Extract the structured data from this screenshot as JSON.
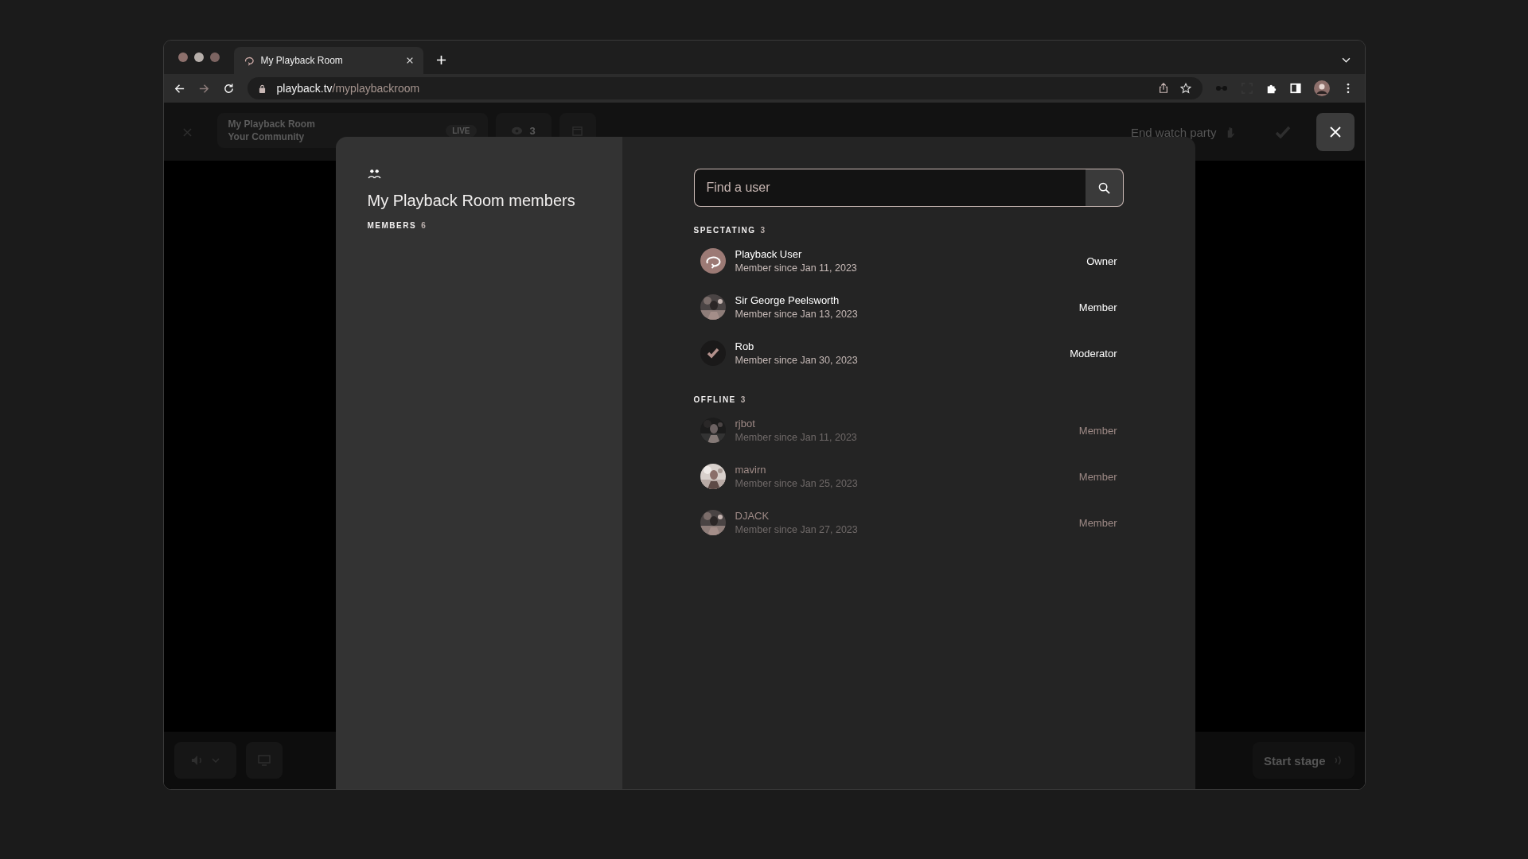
{
  "browser": {
    "tab": {
      "title": "My Playback Room"
    },
    "url": {
      "host": "playback.tv",
      "path": "/myplaybackroom"
    }
  },
  "room_header": {
    "room_name": "My Playback Room",
    "community": "Your Community",
    "live_badge": "LIVE",
    "viewer_count": "3",
    "end_button": "End watch party"
  },
  "bottom_bar": {
    "start_button": "Start stage"
  },
  "members_dialog": {
    "title": "My Playback Room members",
    "members_label": "MEMBERS",
    "members_count": "6",
    "search": {
      "placeholder": "Find a user"
    },
    "sections": [
      {
        "title": "SPECTATING",
        "count": "3",
        "online": true,
        "members": [
          {
            "name": "Playback User",
            "since": "Member since Jan 11, 2023",
            "role": "Owner",
            "kind": "logo"
          },
          {
            "name": "Sir George Peelsworth",
            "since": "Member since Jan 13, 2023",
            "role": "Member"
          },
          {
            "name": "Rob",
            "since": "Member since Jan 30, 2023",
            "role": "Moderator",
            "kind": "check"
          }
        ]
      },
      {
        "title": "OFFLINE",
        "count": "3",
        "online": false,
        "members": [
          {
            "name": "rjbot",
            "since": "Member since Jan 11, 2023",
            "role": "Member"
          },
          {
            "name": "mavirn",
            "since": "Member since Jan 25, 2023",
            "role": "Member"
          },
          {
            "name": "DJACK",
            "since": "Member since Jan 27, 2023",
            "role": "Member"
          }
        ]
      }
    ]
  }
}
